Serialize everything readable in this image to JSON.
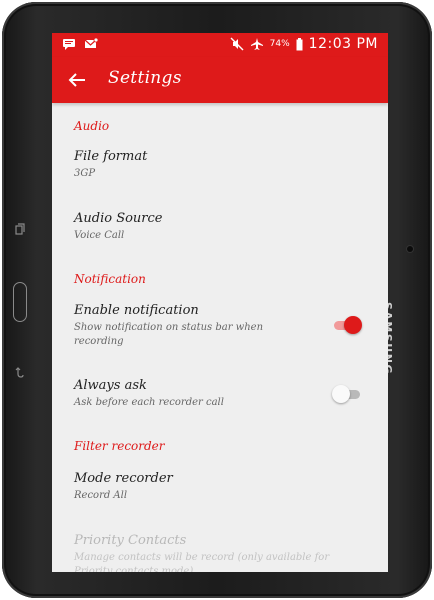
{
  "device": {
    "brand_label": "SAMSUNG"
  },
  "status_bar": {
    "battery_percent": "74%",
    "time": "12:03 PM",
    "icons_left": [
      "message-icon",
      "mail-icon"
    ],
    "icons_right": [
      "mute-icon",
      "airplane-icon",
      "battery-icon"
    ]
  },
  "app_bar": {
    "title": "Settings",
    "back_icon": "arrow-left-icon",
    "color": "#de1a1a"
  },
  "sections": {
    "audio": {
      "header": "Audio",
      "file_format": {
        "title": "File format",
        "summary": "3GP"
      },
      "audio_source": {
        "title": "Audio Source",
        "summary": "Voice Call"
      }
    },
    "notification": {
      "header": "Notification",
      "enable_notification": {
        "title": "Enable notification",
        "summary": "Show notification on status bar when recording",
        "enabled": true
      },
      "always_ask": {
        "title": "Always ask",
        "summary": "Ask before each recorder call",
        "enabled": false
      }
    },
    "filter": {
      "header": "Filter recorder",
      "mode_recorder": {
        "title": "Mode recorder",
        "summary": "Record All"
      },
      "priority_contacts": {
        "title": "Priority Contacts",
        "summary": "Manage contacts will be record (only available for Priority contacts mode)"
      }
    }
  },
  "colors": {
    "accent": "#de1a1a",
    "background": "#efefef",
    "switch_on_track": "#f19a9a"
  }
}
